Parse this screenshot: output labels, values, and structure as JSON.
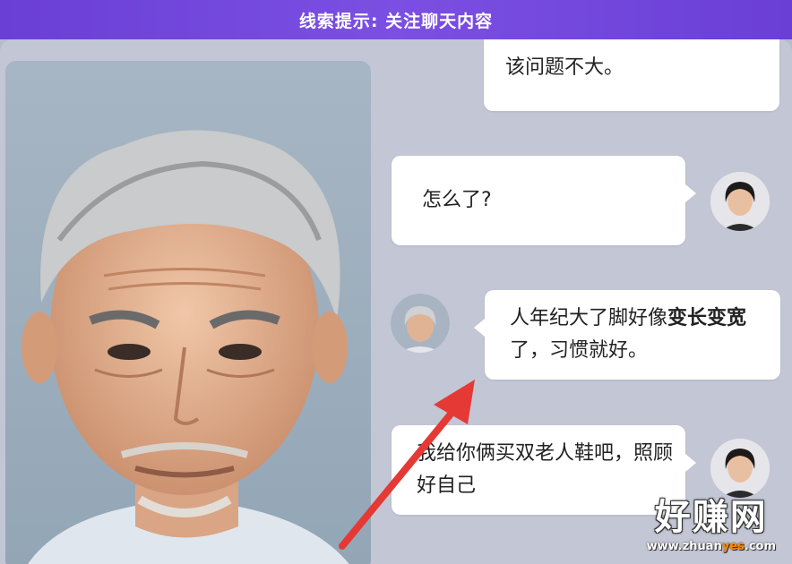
{
  "hint": {
    "text": "线索提示: 关注聊天内容"
  },
  "chat": {
    "messages": [
      {
        "text": "该问题不大。"
      },
      {
        "text": "怎么了?"
      },
      {
        "text_before": "人年纪大了脚好像",
        "text_bold1": "变长",
        "text_bold2": "变宽",
        "text_after": "了，习惯就好。"
      },
      {
        "text": "我给你俩买双老人鞋吧，照顾好自己"
      }
    ]
  },
  "icons": {
    "elder_portrait": "elderly-man-portrait-icon",
    "woman_avatar": "woman-avatar-icon",
    "man_avatar": "elderly-man-avatar-icon",
    "arrow": "red-arrow-icon"
  },
  "watermark": {
    "logo": "好赚网",
    "url_part1": "www.zhuan",
    "url_part2": "yes",
    "url_part3": ".com"
  },
  "colors": {
    "hint_bar": "#6a3fd6",
    "arrow": "#e53935",
    "panel": "#c3c6d4"
  }
}
